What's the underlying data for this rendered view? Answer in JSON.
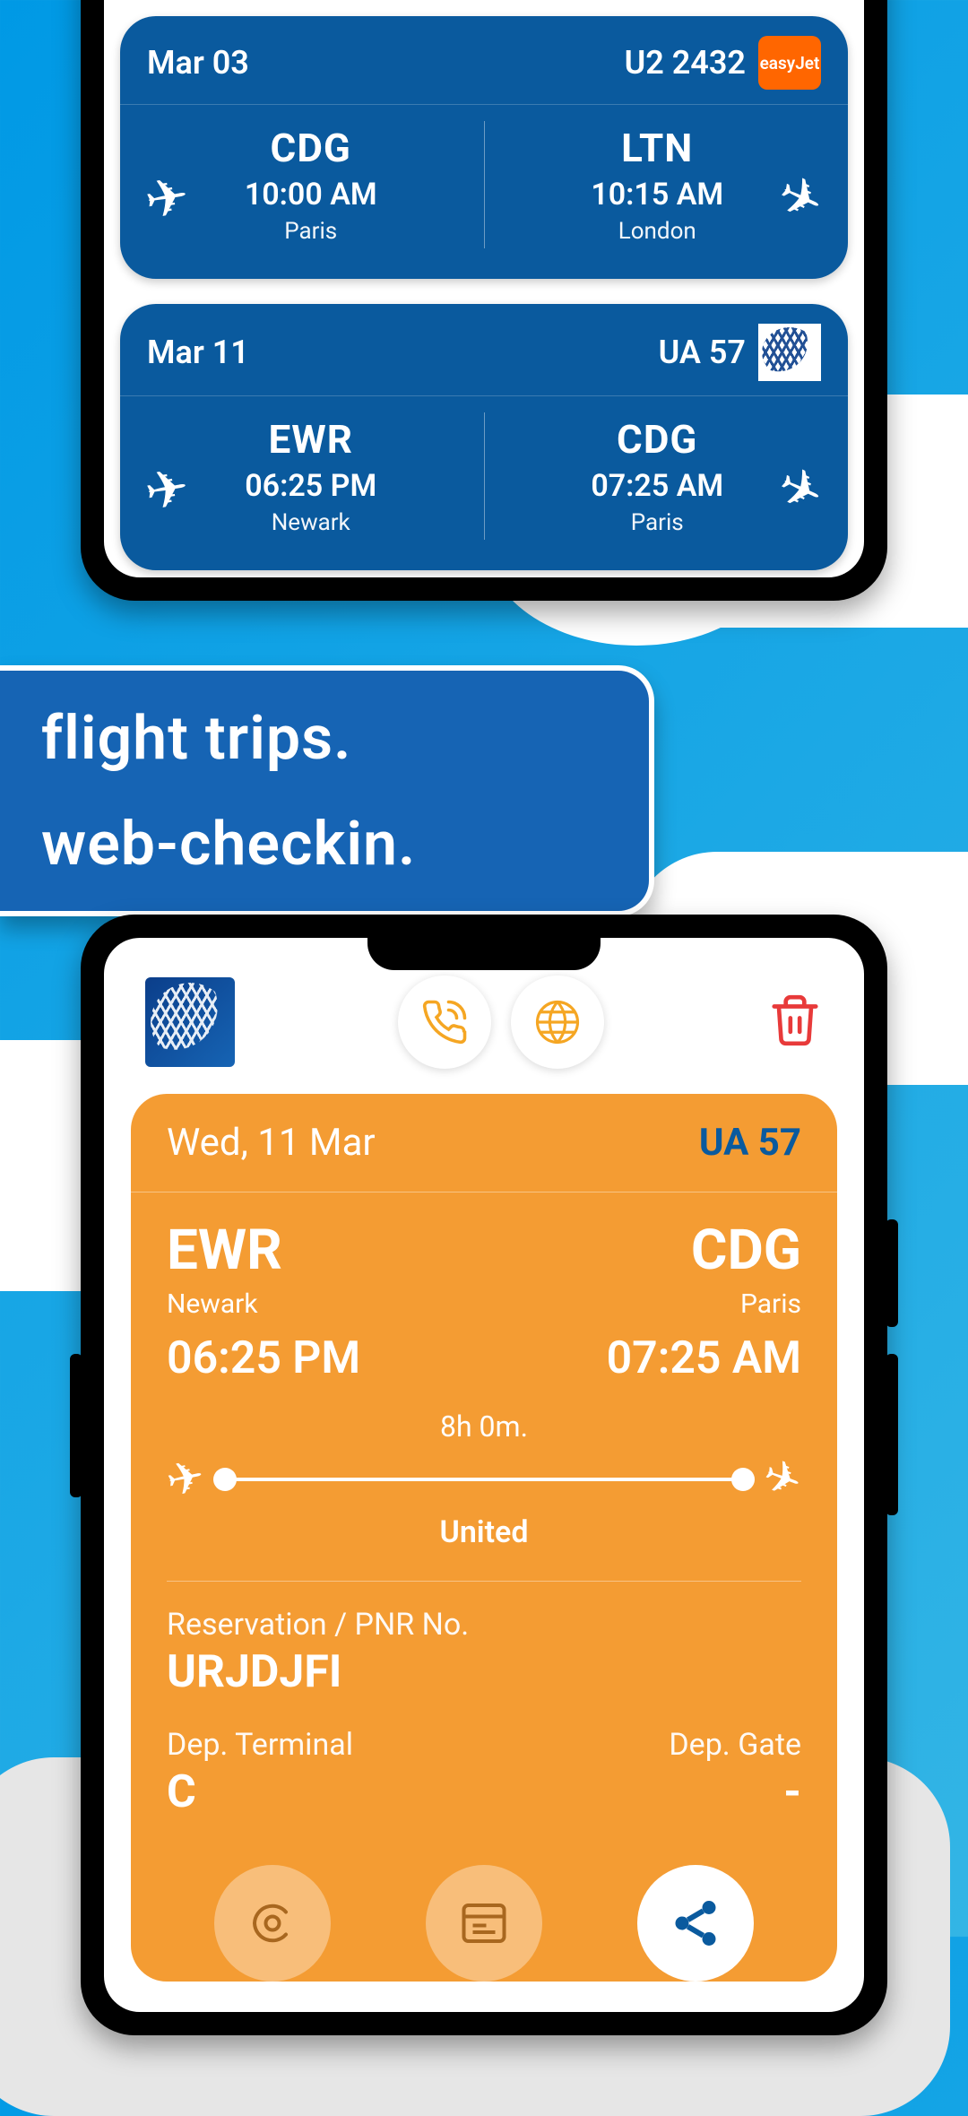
{
  "cards": [
    {
      "date": "Mar 03",
      "flight": "U2 2432",
      "airline_badge": "easyJet",
      "dep": {
        "code": "CDG",
        "time": "10:00 AM",
        "city": "Paris"
      },
      "arr": {
        "code": "LTN",
        "time": "10:15 AM",
        "city": "London"
      }
    },
    {
      "date": "Mar 11",
      "flight": "UA 57",
      "dep": {
        "code": "EWR",
        "time": "06:25 PM",
        "city": "Newark"
      },
      "arr": {
        "code": "CDG",
        "time": "07:25 AM",
        "city": "Paris"
      }
    }
  ],
  "banner": {
    "line1": "flight trips.",
    "line2": "web-checkin."
  },
  "detail": {
    "date": "Wed, 11 Mar",
    "flight": "UA 57",
    "dep": {
      "code": "EWR",
      "city": "Newark",
      "time": "06:25 PM"
    },
    "arr": {
      "code": "CDG",
      "city": "Paris",
      "time": "07:25 AM"
    },
    "duration": "8h 0m.",
    "airline": "United",
    "pnr_label": "Reservation / PNR No.",
    "pnr": "URJDJFI",
    "terminal_label": "Dep. Terminal",
    "terminal": "C",
    "gate_label": "Dep. Gate",
    "gate": "-"
  }
}
